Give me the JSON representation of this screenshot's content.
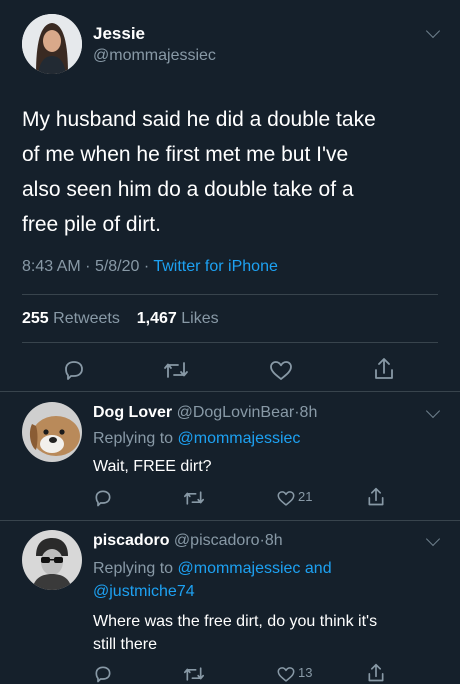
{
  "main_tweet": {
    "display_name": "Jessie",
    "handle": "@mommajessiec",
    "text_lines": [
      "My husband said he did a double take",
      "of me when he first met me but I've",
      "also seen him do a double take of a",
      "free pile of dirt."
    ],
    "time": "8:43 AM",
    "date": "5/8/20",
    "source": "Twitter for iPhone",
    "retweets_count": "255",
    "retweets_label": "Retweets",
    "likes_count": "1,467",
    "likes_label": "Likes"
  },
  "replies": [
    {
      "display_name": "Dog Lover",
      "handle": "@DogLovinBear",
      "time": "8h",
      "replying_to_label": "Replying to",
      "replying_to_line1": "@mommajessiec",
      "text": "Wait, FREE dirt?",
      "like_count": "21"
    },
    {
      "display_name": "piscadoro",
      "handle": "@piscadoro",
      "time": "8h",
      "replying_to_label": "Replying to",
      "replying_to_line1": "@mommajessiec",
      "replying_to_and": "and",
      "replying_to_line2": "@justmiche74",
      "text_lines": [
        "Where was the free dirt, do you think it's",
        "still there"
      ],
      "like_count": "13"
    }
  ],
  "separator_dot": "·",
  "colors": {
    "background": "#15202b",
    "text": "#ffffff",
    "muted": "#8899a6",
    "accent": "#1da1f2",
    "divider": "#38444d"
  },
  "icons": [
    "reply-icon",
    "retweet-icon",
    "like-icon",
    "share-icon",
    "chevron-down-icon"
  ]
}
